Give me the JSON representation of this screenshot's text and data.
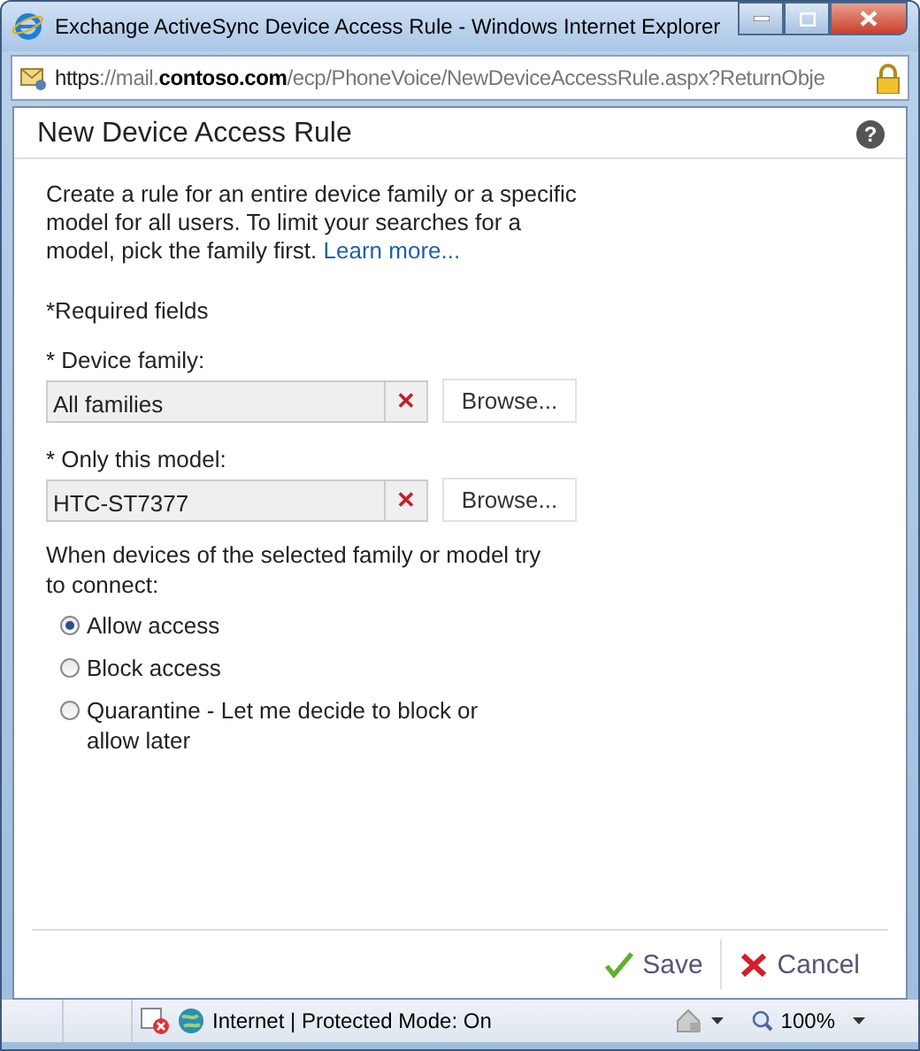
{
  "window": {
    "title": "Exchange ActiveSync Device Access Rule - Windows Internet Explorer"
  },
  "address_bar": {
    "segments": [
      {
        "text": "https",
        "kind": "plain"
      },
      {
        "text": "://mail.",
        "kind": "muted"
      },
      {
        "text": "contoso.com",
        "kind": "strong"
      },
      {
        "text": "/ecp/PhoneVoice/NewDeviceAccessRule.aspx?ReturnObje",
        "kind": "muted"
      }
    ]
  },
  "dialog": {
    "title": "New Device Access Rule",
    "help": "?",
    "intro": "Create a rule for an entire device family or a specific model for all users. To limit your searches for a model, pick the family first.",
    "learn_more": "Learn more...",
    "required_note": "*Required fields",
    "fields": [
      {
        "label": "* Device family:",
        "value": "All families",
        "clear": "✕",
        "browse": "Browse..."
      },
      {
        "label": "* Only this model:",
        "value": "HTC-ST7377",
        "clear": "✕",
        "browse": "Browse..."
      }
    ],
    "question": "When devices of the selected family or model try to connect:",
    "options": [
      {
        "label": "Allow access",
        "selected": true
      },
      {
        "label": "Block access",
        "selected": false
      },
      {
        "label": "Quarantine - Let me decide to block or allow later",
        "selected": false
      }
    ],
    "buttons": [
      {
        "label": "Save",
        "kind": "save"
      },
      {
        "label": "Cancel",
        "kind": "cancel"
      }
    ]
  },
  "status_bar": {
    "zone": "Internet | Protected Mode: On",
    "zoom": "100%"
  }
}
